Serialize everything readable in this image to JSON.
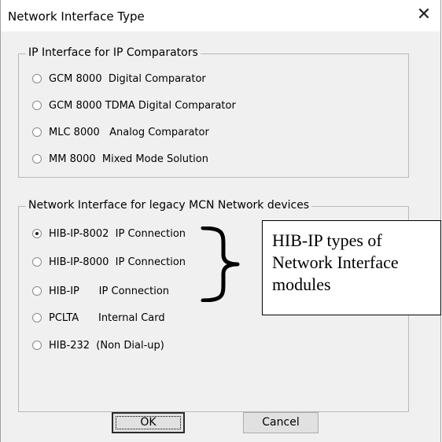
{
  "window": {
    "title": "Network Interface Type",
    "close_glyph": "✕",
    "close_icon": "close-icon"
  },
  "group_ip": {
    "legend": "IP Interface for IP Comparators",
    "options": [
      {
        "label": "GCM 8000  Digital Comparator",
        "selected": false
      },
      {
        "label": "GCM 8000 TDMA Digital Comparator",
        "selected": false
      },
      {
        "label": "MLC 8000   Analog Comparator",
        "selected": false
      },
      {
        "label": "MM 8000  Mixed Mode Solution",
        "selected": false
      }
    ]
  },
  "group_legacy": {
    "legend": "Network Interface for legacy MCN Network devices",
    "options": [
      {
        "label": "HIB-IP-8002  IP Connection",
        "selected": true
      },
      {
        "label": "HIB-IP-8000  IP Connection",
        "selected": false
      },
      {
        "label": "HIB-IP      IP Connection",
        "selected": false
      },
      {
        "label": "PCLTA      Internal Card",
        "selected": false
      },
      {
        "label": "HIB-232  (Non Dial-up)",
        "selected": false
      }
    ]
  },
  "buttons": {
    "ok": "OK",
    "cancel": "Cancel"
  },
  "annotation": {
    "lines": [
      "HIB-IP types of",
      "Network Interface",
      "modules"
    ],
    "brace_icon": "curly-brace-icon"
  }
}
